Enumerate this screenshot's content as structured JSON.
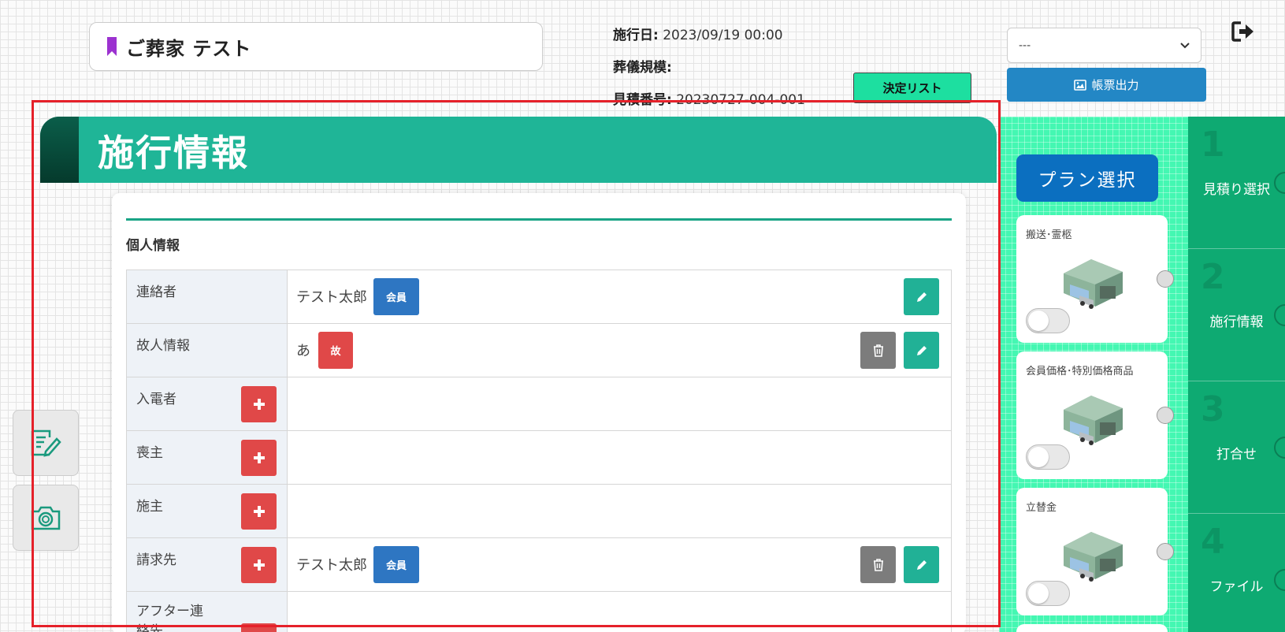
{
  "header": {
    "family_title": "ご葬家 テスト",
    "date_label": "施行日:",
    "date_value": "2023/09/19 00:00",
    "scale_label": "葬儀規模:",
    "scale_value": "",
    "estimate_label": "見積番号:",
    "estimate_value": "20230727-004-001",
    "decision_button": "決定リスト",
    "select_value": "---",
    "report_button": "帳票出力"
  },
  "section": {
    "title": "施行情報",
    "subtitle": "個人情報"
  },
  "rows": [
    {
      "label": "連絡者",
      "name": "テスト太郎",
      "badge": "会員"
    },
    {
      "label": "故人情報",
      "name": "あ",
      "badge": "故"
    },
    {
      "label": "入電者"
    },
    {
      "label": "喪主"
    },
    {
      "label": "施主"
    },
    {
      "label": "請求先",
      "name": "テスト太郎",
      "badge": "会員"
    },
    {
      "label": "アフター連絡先"
    }
  ],
  "plan": {
    "button": "プラン選択",
    "cards": [
      {
        "label": "搬送･霊柩",
        "enabled": false
      },
      {
        "label": "会員価格･特別価格商品",
        "enabled": false
      },
      {
        "label": "立替金",
        "enabled": false
      }
    ]
  },
  "steps": [
    {
      "num": "1",
      "label": "見積り選択"
    },
    {
      "num": "2",
      "label": "施行情報"
    },
    {
      "num": "3",
      "label": "打合せ"
    },
    {
      "num": "4",
      "label": "ファイル"
    }
  ],
  "colors": {
    "primary": "#1fb597",
    "plan_blue": "#0b6fc0",
    "step_green": "#0eaa72",
    "danger": "#e04848",
    "member_blue": "#2e76c2",
    "highlight_frame": "#e5212a"
  }
}
